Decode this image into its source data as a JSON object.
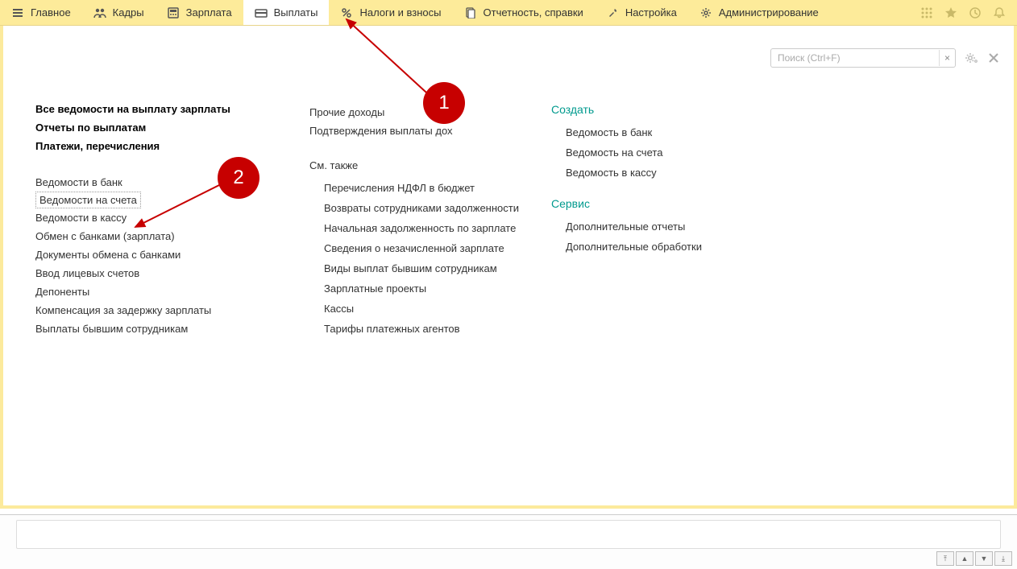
{
  "nav": {
    "items": [
      {
        "label": "Главное"
      },
      {
        "label": "Кадры"
      },
      {
        "label": "Зарплата"
      },
      {
        "label": "Выплаты"
      },
      {
        "label": "Налоги и взносы"
      },
      {
        "label": "Отчетность, справки"
      },
      {
        "label": "Настройка"
      },
      {
        "label": "Администрирование"
      }
    ]
  },
  "search": {
    "placeholder": "Поиск (Ctrl+F)"
  },
  "col1": {
    "heads": [
      "Все ведомости на выплату зарплаты",
      "Отчеты по выплатам",
      "Платежи, перечисления"
    ],
    "links": [
      "Ведомости в банк",
      "Ведомости на счета",
      "Ведомости в кассу",
      "Обмен с банками (зарплата)",
      "Документы обмена с банками",
      "Ввод лицевых счетов",
      "Депоненты",
      "Компенсация за задержку зарплаты",
      "Выплаты бывшим сотрудникам"
    ]
  },
  "col2": {
    "top": [
      "Прочие доходы",
      "Подтверждения выплаты дох"
    ],
    "sub_head": "См. также",
    "links": [
      "Перечисления НДФЛ в бюджет",
      "Возвраты сотрудниками задолженности",
      "Начальная задолженность по зарплате",
      "Сведения о незачисленной зарплате",
      "Виды выплат бывшим сотрудникам",
      "Зарплатные проекты",
      "Кассы",
      "Тарифы платежных агентов"
    ]
  },
  "col3": {
    "create_head": "Создать",
    "create": [
      "Ведомость в банк",
      "Ведомость на счета",
      "Ведомость в кассу"
    ],
    "service_head": "Сервис",
    "service": [
      "Дополнительные отчеты",
      "Дополнительные обработки"
    ]
  },
  "annot": {
    "b1": "1",
    "b2": "2"
  }
}
